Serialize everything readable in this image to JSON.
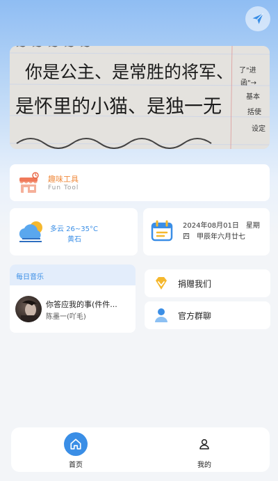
{
  "banner": {
    "lines": [
      "你是公主、是常胜的将军、",
      "是怀里的小猫、是独一无",
      "了\"进",
      "函\"→",
      "基本",
      "括使",
      "设定"
    ]
  },
  "fun_tool": {
    "title": "趣味工具",
    "subtitle": "Fun Tool"
  },
  "weather": {
    "condition_temp": "多云 26~35°C",
    "location": "黄石"
  },
  "date_card": {
    "text": "2024年08月01日　星期四　甲辰年六月廿七"
  },
  "music": {
    "header": "每日音乐",
    "song": "你答应我的事(件件...",
    "artist": "陈墨一(吖毛)"
  },
  "buttons": {
    "donate": "捐赠我们",
    "group": "官方群聊"
  },
  "tabbar": {
    "home": "首页",
    "mine": "我的"
  },
  "colors": {
    "accent": "#3a8ee6",
    "orange": "#f08a3c",
    "gold": "#f5b82e"
  },
  "icons": [
    "send-icon",
    "fun-tool-icon",
    "weather-cloud-icon",
    "calendar-icon",
    "diamond-icon",
    "user-icon",
    "home-icon",
    "person-icon"
  ]
}
